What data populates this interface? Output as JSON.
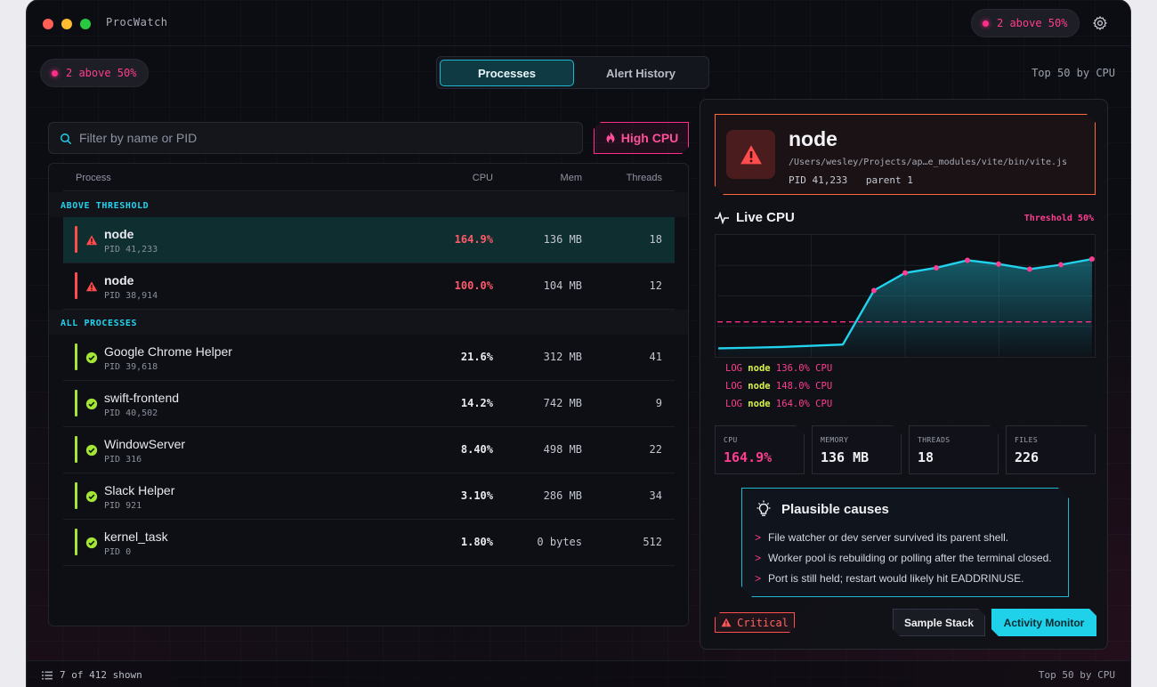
{
  "app": {
    "title": "ProcWatch"
  },
  "alerts": {
    "pill_label": "2 above 50%"
  },
  "tabs": [
    {
      "label": "Processes"
    },
    {
      "label": "Alert History"
    }
  ],
  "top_label": "Top 50 by CPU",
  "search": {
    "placeholder": "Filter by name or PID"
  },
  "filter_button": {
    "label": "High CPU"
  },
  "table": {
    "columns": [
      "Process",
      "CPU",
      "Mem",
      "Threads"
    ],
    "groups": [
      "ABOVE THRESHOLD",
      "ALL PROCESSES"
    ],
    "rows": [
      {
        "name": "node",
        "pid": "PID 41,233",
        "cpu": "164.9%",
        "mem": "136 MB",
        "threads": "18"
      },
      {
        "name": "node",
        "pid": "PID 38,914",
        "cpu": "100.0%",
        "mem": "104 MB",
        "threads": "12"
      },
      {
        "name": "Google Chrome Helper",
        "pid": "PID 39,618",
        "cpu": "21.6%",
        "mem": "312 MB",
        "threads": "41"
      },
      {
        "name": "swift-frontend",
        "pid": "PID 40,502",
        "cpu": "14.2%",
        "mem": "742 MB",
        "threads": "9"
      },
      {
        "name": "WindowServer",
        "pid": "PID 316",
        "cpu": "8.40%",
        "mem": "498 MB",
        "threads": "22"
      },
      {
        "name": "Slack Helper",
        "pid": "PID 921",
        "cpu": "3.10%",
        "mem": "286 MB",
        "threads": "34"
      },
      {
        "name": "kernel_task",
        "pid": "PID 0",
        "cpu": "1.80%",
        "mem": "0 bytes",
        "threads": "512"
      }
    ]
  },
  "detail": {
    "name": "node",
    "path": "/Users/wesley/Projects/ap…e_modules/vite/bin/vite.js",
    "pid": "PID 41,233",
    "parent": "parent 1",
    "live_title": "Live CPU",
    "threshold_label": "Threshold 50%",
    "log": [
      {
        "tag": "LOG",
        "name": "node",
        "value": "136.0% CPU"
      },
      {
        "tag": "LOG",
        "name": "node",
        "value": "148.0% CPU"
      },
      {
        "tag": "LOG",
        "name": "node",
        "value": "164.0% CPU"
      }
    ],
    "stats": [
      {
        "label": "CPU",
        "value": "164.9%"
      },
      {
        "label": "MEMORY",
        "value": "136 MB"
      },
      {
        "label": "THREADS",
        "value": "18"
      },
      {
        "label": "FILES",
        "value": "226"
      }
    ],
    "causes_title": "Plausible causes",
    "causes": [
      "File watcher or dev server survived its parent shell.",
      "Worker pool is rebuilding or polling after the terminal closed.",
      "Port is still held; restart would likely hit EADDRINUSE."
    ],
    "severity": "Critical",
    "btn_sample": "Sample Stack",
    "btn_activity": "Activity Monitor"
  },
  "footer": {
    "shown": "7 of 412 shown",
    "right": "Top 50 by CPU"
  },
  "colors": {
    "accent_cyan": "#1fd2ea",
    "accent_pink": "#ff2e88",
    "danger": "#ff5a6a",
    "ok": "#a3e635"
  },
  "chart_data": {
    "type": "line",
    "threshold": 50,
    "ylim": [
      0,
      180
    ],
    "values": [
      8,
      9,
      10,
      12,
      14,
      100,
      128,
      136,
      148,
      142,
      134,
      141,
      150
    ]
  }
}
